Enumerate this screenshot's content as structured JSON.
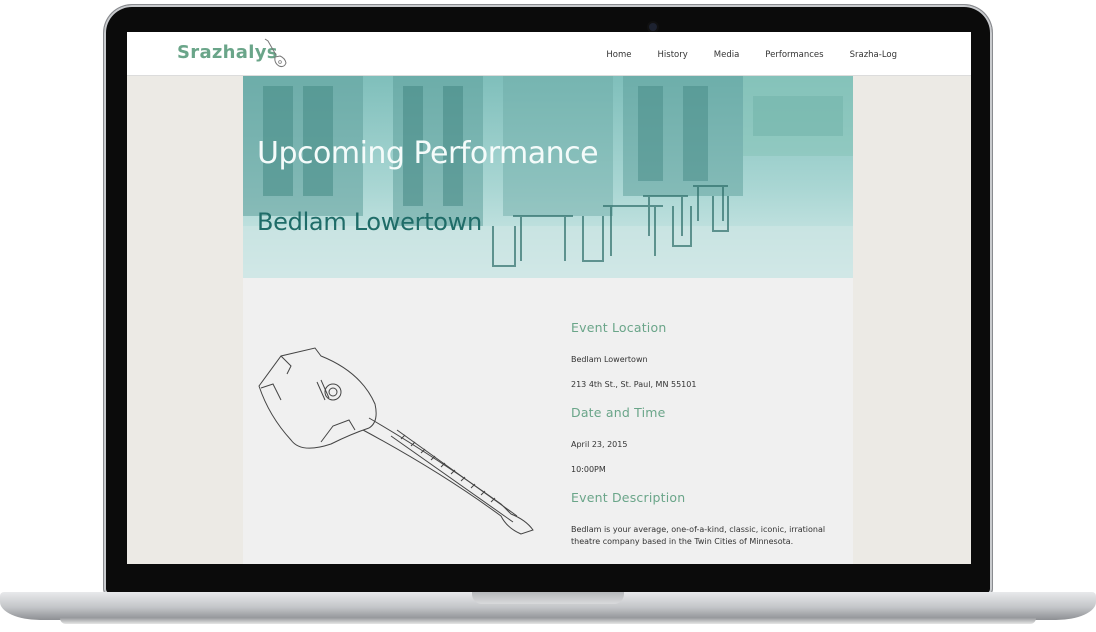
{
  "site": {
    "logo_text": "Srazhalys",
    "nav": [
      "Home",
      "History",
      "Media",
      "Performances",
      "Srazha-Log"
    ]
  },
  "hero": {
    "title": "Upcoming Performance",
    "subtitle": "Bedlam Lowertown"
  },
  "event": {
    "location_heading": "Event Location",
    "venue": "Bedlam Lowertown",
    "address": "213 4th St., St. Paul, MN 55101",
    "datetime_heading": "Date and Time",
    "date": "April 23, 2015",
    "time": "10:00PM",
    "description_heading": "Event Description",
    "description": "Bedlam is your average, one-of-a-kind, classic, iconic, irrational theatre company based in the Twin Cities of Minnesota."
  },
  "colors": {
    "accent": "#6aa589",
    "hero_tint": "#7fbfbb",
    "subtitle": "#1f6c68"
  }
}
